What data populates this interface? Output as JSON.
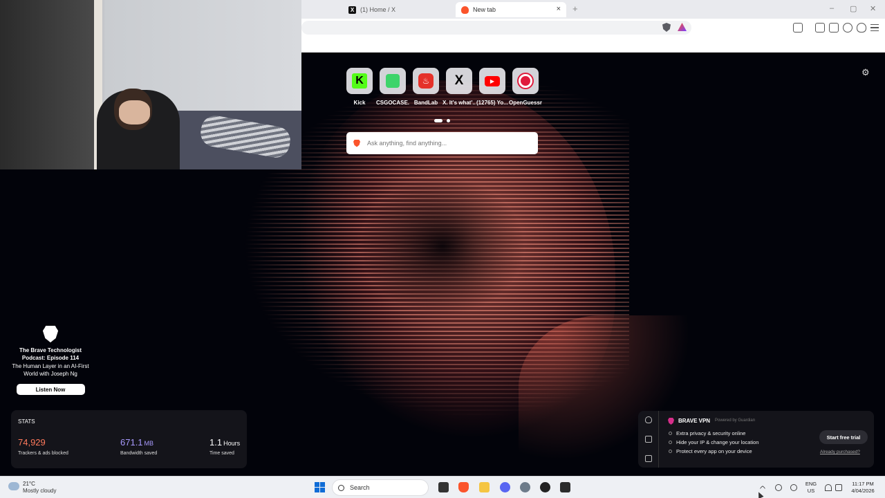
{
  "browser": {
    "tabs": [
      {
        "label": "(1) Home / X"
      },
      {
        "label": "New tab"
      }
    ],
    "new_tab_symbol": "+",
    "close_symbol": "×",
    "window_controls": [
      "–",
      "▢",
      "✕"
    ]
  },
  "ntp": {
    "settings_icon": "gear-icon",
    "top_sites": [
      {
        "label": "Kick",
        "icon": "kick-icon"
      },
      {
        "label": "CSGOCASE...",
        "icon": "csgocase-icon"
      },
      {
        "label": "BandLab",
        "icon": "bandlab-icon"
      },
      {
        "label": "X. It's what'...",
        "icon": "x-icon"
      },
      {
        "label": "(12765) Yo...",
        "icon": "youtube-icon"
      },
      {
        "label": "OpenGuessr",
        "icon": "openguessr-icon"
      }
    ],
    "search": {
      "placeholder": "Ask anything, find anything..."
    },
    "promo": {
      "title": "The Brave Technologist Podcast: Episode 114",
      "subtitle": "The Human Layer in an AI-First World with Joseph Ng",
      "button": "Listen Now"
    },
    "stats": {
      "title": "STATS",
      "trackers": {
        "value": "74,929",
        "label": "Trackers & ads blocked",
        "color": "#ff7a5c"
      },
      "bandwidth": {
        "value": "671.1",
        "unit": "MB",
        "label": "Bandwidth saved",
        "color": "#a99bff"
      },
      "time": {
        "value": "1.1",
        "unit": "Hours",
        "label": "Time saved",
        "color": "#ffffff"
      }
    },
    "vpn": {
      "title": "BRAVE VPN",
      "powered": "Powered by Guardian",
      "features": [
        "Extra privacy & security online",
        "Hide your IP & change your location",
        "Protect every app on your device"
      ],
      "cta": "Start free trial",
      "link": "Already purchased?"
    }
  },
  "taskbar": {
    "weather": {
      "temp": "21°C",
      "desc": "Mostly cloudy"
    },
    "search_label": "Search",
    "lang": "ENG",
    "region": "US",
    "time": "11:17 PM",
    "date": "4/04/2026"
  },
  "colors": {
    "brave_orange": "#fb542b",
    "windows_blue": "#0f6cd6"
  }
}
